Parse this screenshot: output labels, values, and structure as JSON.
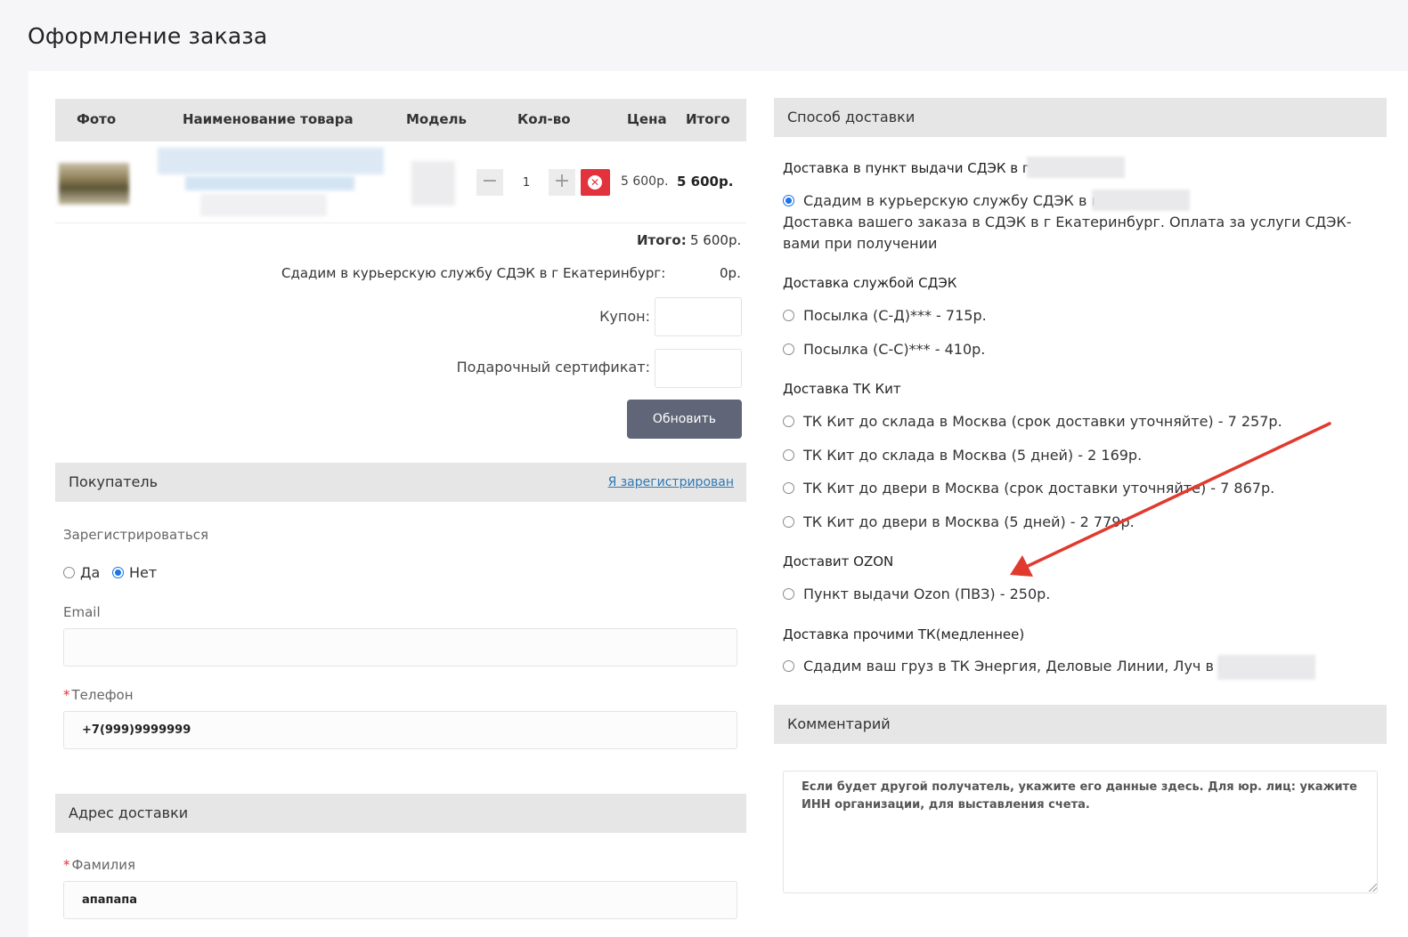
{
  "page_title": "Оформление заказа",
  "cart": {
    "columns": [
      "Фото",
      "Наименование товара",
      "Модель",
      "Кол-во",
      "Цена",
      "Итого"
    ],
    "item": {
      "qty": "1",
      "price": "5 600р.",
      "total": "5 600р."
    },
    "total_label": "Итого:",
    "total_value": "5 600р.",
    "shipping_label": "Сдадим в курьерскую службу СДЭК в г Екатеринбург:",
    "shipping_value": "0р.",
    "coupon_label": "Купон:",
    "certificate_label": "Подарочный сертификат:",
    "update_button": "Обновить"
  },
  "buyer": {
    "header": "Покупатель",
    "login_link": "Я зарегистрирован",
    "register_label": "Зарегистрироваться",
    "register_yes": "Да",
    "register_no": "Нет",
    "email_label": "Email",
    "email_value": "",
    "phone_label": "Телефон",
    "phone_value": "+7(999)9999999"
  },
  "address": {
    "header": "Адрес доставки",
    "surname_label": "Фамилия",
    "surname_value": "апапапа"
  },
  "delivery": {
    "header": "Способ доставки",
    "group1_title": "Доставка в пункт выдачи СДЭК в г",
    "group1_option": "Сдадим в курьерскую службу СДЭК в г",
    "group1_desc": "Доставка вашего заказа в СДЭК в г Екатеринбург. Оплата за услуги СДЭК-вами при получении",
    "group2_title": "Доставка службой СДЭК",
    "group2_options": [
      "Посылка (С-Д)*** - 715р.",
      "Посылка (С-С)*** - 410р."
    ],
    "group3_title": "Доставка ТК Кит",
    "group3_options": [
      "ТК Кит до склада в Москва (срок доставки уточняйте) - 7 257р.",
      "ТК Кит до склада в Москва (5 дней) - 2 169р.",
      "ТК Кит до двери в Москва (срок доставки уточняйте) - 7 867р.",
      "ТК Кит до двери в Москва (5 дней) - 2 779р."
    ],
    "group4_title": "Доставит OZON",
    "group4_option": "Пункт выдачи Ozon (ПВЗ) - 250р.",
    "group5_title": "Доставка прочими ТК(медленнее)",
    "group5_option": "Сдадим ваш груз в ТК Энергия, Деловые Линии, Луч в г"
  },
  "comment": {
    "header": "Комментарий",
    "placeholder": "Если будет другой получатель, укажите его данные здесь. Для юр. лиц: укажите ИНН организации, для выставления счета."
  },
  "colors": {
    "accent": "#1a73e8",
    "remove_button": "#e2323c",
    "update_button": "#606678",
    "annotation_arrow": "#e03a2f"
  }
}
